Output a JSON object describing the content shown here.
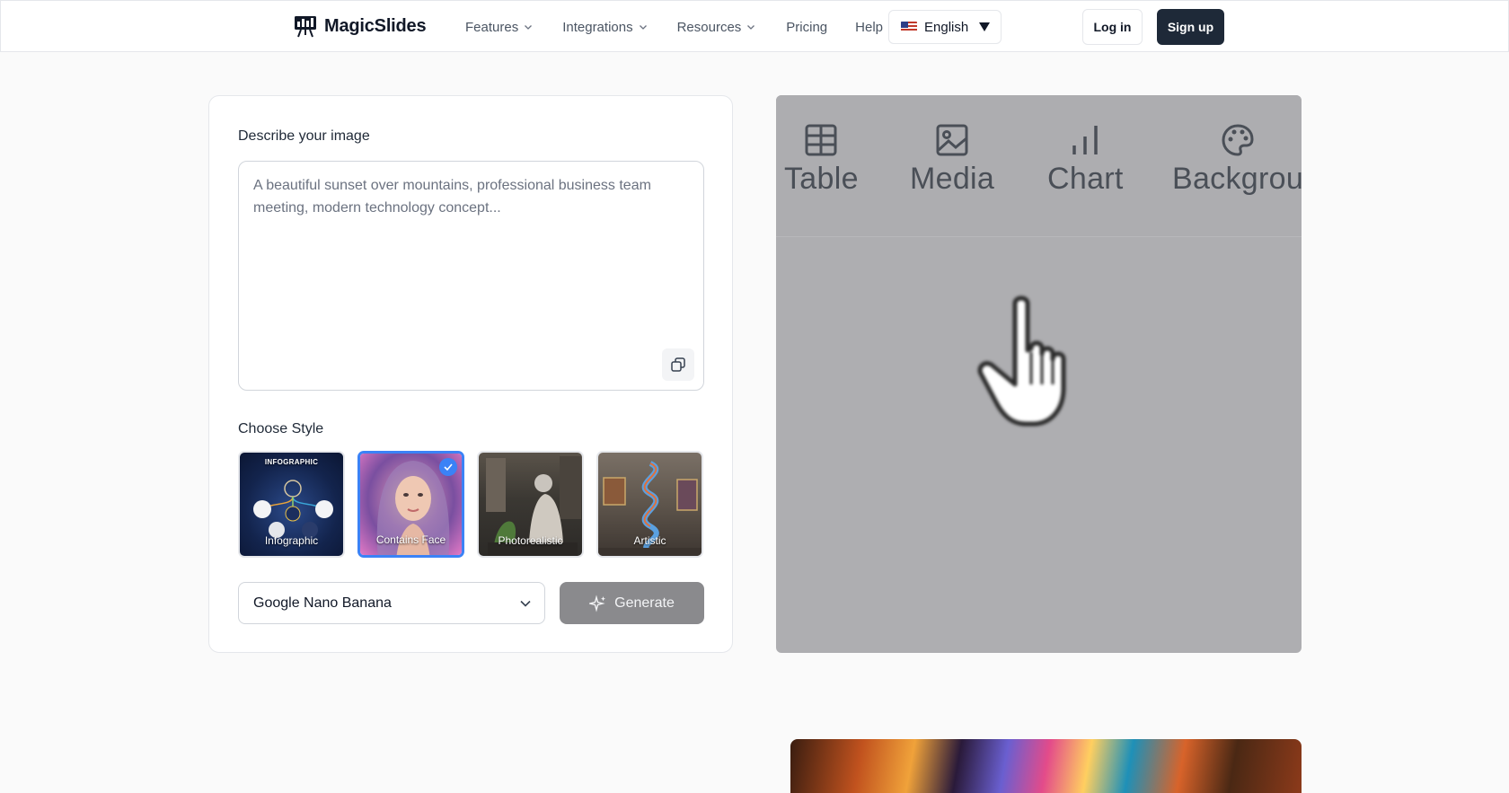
{
  "header": {
    "brand": "MagicSlides",
    "nav": [
      {
        "label": "Features",
        "has_menu": true
      },
      {
        "label": "Integrations",
        "has_menu": true
      },
      {
        "label": "Resources",
        "has_menu": true
      },
      {
        "label": "Pricing",
        "has_menu": false
      },
      {
        "label": "Help",
        "has_menu": false
      }
    ],
    "language": "English",
    "login_label": "Log in",
    "signup_label": "Sign up"
  },
  "form": {
    "describe_label": "Describe your image",
    "prompt_placeholder": "A beautiful sunset over mountains, professional business team meeting, modern technology concept...",
    "style_label": "Choose Style",
    "styles": [
      {
        "label": "Infographic",
        "badge": "INFOGRAPHIC",
        "selected": false
      },
      {
        "label": "Contains Face",
        "selected": true
      },
      {
        "label": "Photorealistic",
        "selected": false
      },
      {
        "label": "Artistic",
        "selected": false
      }
    ],
    "model_selected": "Google Nano Banana",
    "generate_label": "Generate"
  },
  "preview": {
    "tools": [
      "Table",
      "Media",
      "Chart",
      "Backgrou"
    ]
  },
  "colors": {
    "primary_dark": "#1e2938",
    "accent_blue": "#3b82f6",
    "preview_gray": "#aeaeb1",
    "generate_disabled": "#8a8a8d"
  }
}
